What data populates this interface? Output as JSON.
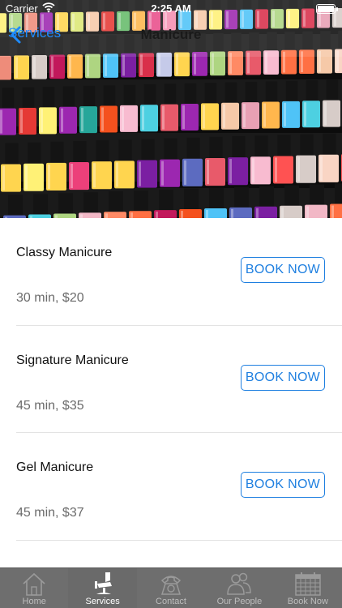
{
  "status_bar": {
    "carrier": "Carrier",
    "time": "2:25 AM"
  },
  "nav": {
    "back_label": "Services",
    "title": "Manicure"
  },
  "services": [
    {
      "name": "Classy Manicure",
      "details": "30 min, $20",
      "button": "BOOK NOW"
    },
    {
      "name": "Signature Manicure",
      "details": "45 min, $35",
      "button": "BOOK NOW"
    },
    {
      "name": "Gel Manicure",
      "details": "45 min, $37",
      "button": "BOOK NOW"
    }
  ],
  "tabs": [
    {
      "label": "Home",
      "icon": "home-icon",
      "active": false
    },
    {
      "label": "Services",
      "icon": "salon-chair-icon",
      "active": true
    },
    {
      "label": "Contact",
      "icon": "phone-icon",
      "active": false
    },
    {
      "label": "Our People",
      "icon": "people-icon",
      "active": false
    },
    {
      "label": "Book Now",
      "icon": "calendar-icon",
      "active": false
    }
  ],
  "colors": {
    "accent": "#1e7fe0",
    "back_link": "#1e8bff",
    "tabbar_bg": "#6e6e6e",
    "divider": "#e3e3e3"
  }
}
